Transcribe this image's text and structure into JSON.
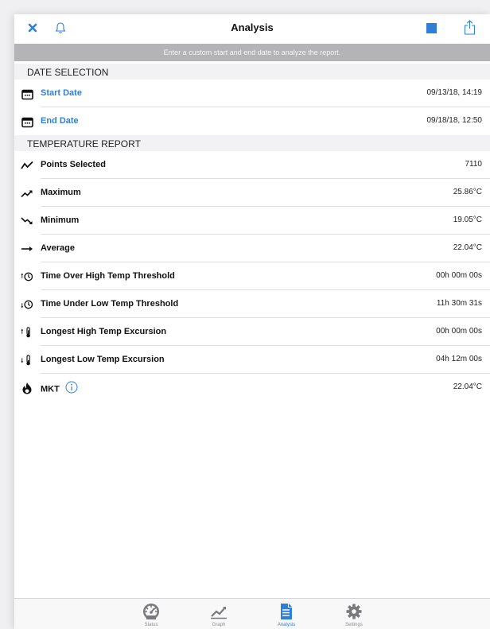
{
  "nav": {
    "title": "Analysis",
    "close_icon": "close-icon",
    "bell_icon": "bell-icon",
    "stop_icon": "stop-icon",
    "share_icon": "share-icon"
  },
  "banner": "Enter a custom start and end date to analyze the report.",
  "date_selection": {
    "header": "DATE SELECTION",
    "rows": [
      {
        "label": "Start Date",
        "value": "09/13/18, 14:19",
        "icon": "calendar-icon"
      },
      {
        "label": "End Date",
        "value": "09/18/18, 12:50",
        "icon": "calendar-icon"
      }
    ]
  },
  "temperature_report": {
    "header": "TEMPERATURE REPORT",
    "rows": [
      {
        "label": "Points Selected",
        "value": "7110",
        "icon": "zigzag-icon"
      },
      {
        "label": "Maximum",
        "value": "25.86°C",
        "icon": "trend-up-icon"
      },
      {
        "label": "Minimum",
        "value": "19.05°C",
        "icon": "trend-down-icon"
      },
      {
        "label": "Average",
        "value": "22.04°C",
        "icon": "arrow-right-icon"
      },
      {
        "label": "Time Over High Temp Threshold",
        "value": "00h 00m 00s",
        "icon": "clock-up-icon"
      },
      {
        "label": "Time Under Low Temp Threshold",
        "value": "11h 30m 31s",
        "icon": "clock-down-icon"
      },
      {
        "label": "Longest High Temp Excursion",
        "value": "00h 00m 00s",
        "icon": "thermometer-up-icon"
      },
      {
        "label": "Longest Low Temp Excursion",
        "value": "04h 12m 00s",
        "icon": "thermometer-down-icon"
      },
      {
        "label": "MKT",
        "value": "22.04°C",
        "icon": "flame-icon"
      }
    ]
  },
  "tabs": [
    {
      "label": "Status",
      "icon": "speedometer-icon",
      "active": false
    },
    {
      "label": "Graph",
      "icon": "graph-icon",
      "active": false
    },
    {
      "label": "Analysis",
      "icon": "document-icon",
      "active": true
    },
    {
      "label": "Settings",
      "icon": "gear-icon",
      "active": false
    }
  ],
  "colors": {
    "accent": "#2f7fd8",
    "banner": "#b4b4b6",
    "section_header": "#f2f2f4"
  }
}
